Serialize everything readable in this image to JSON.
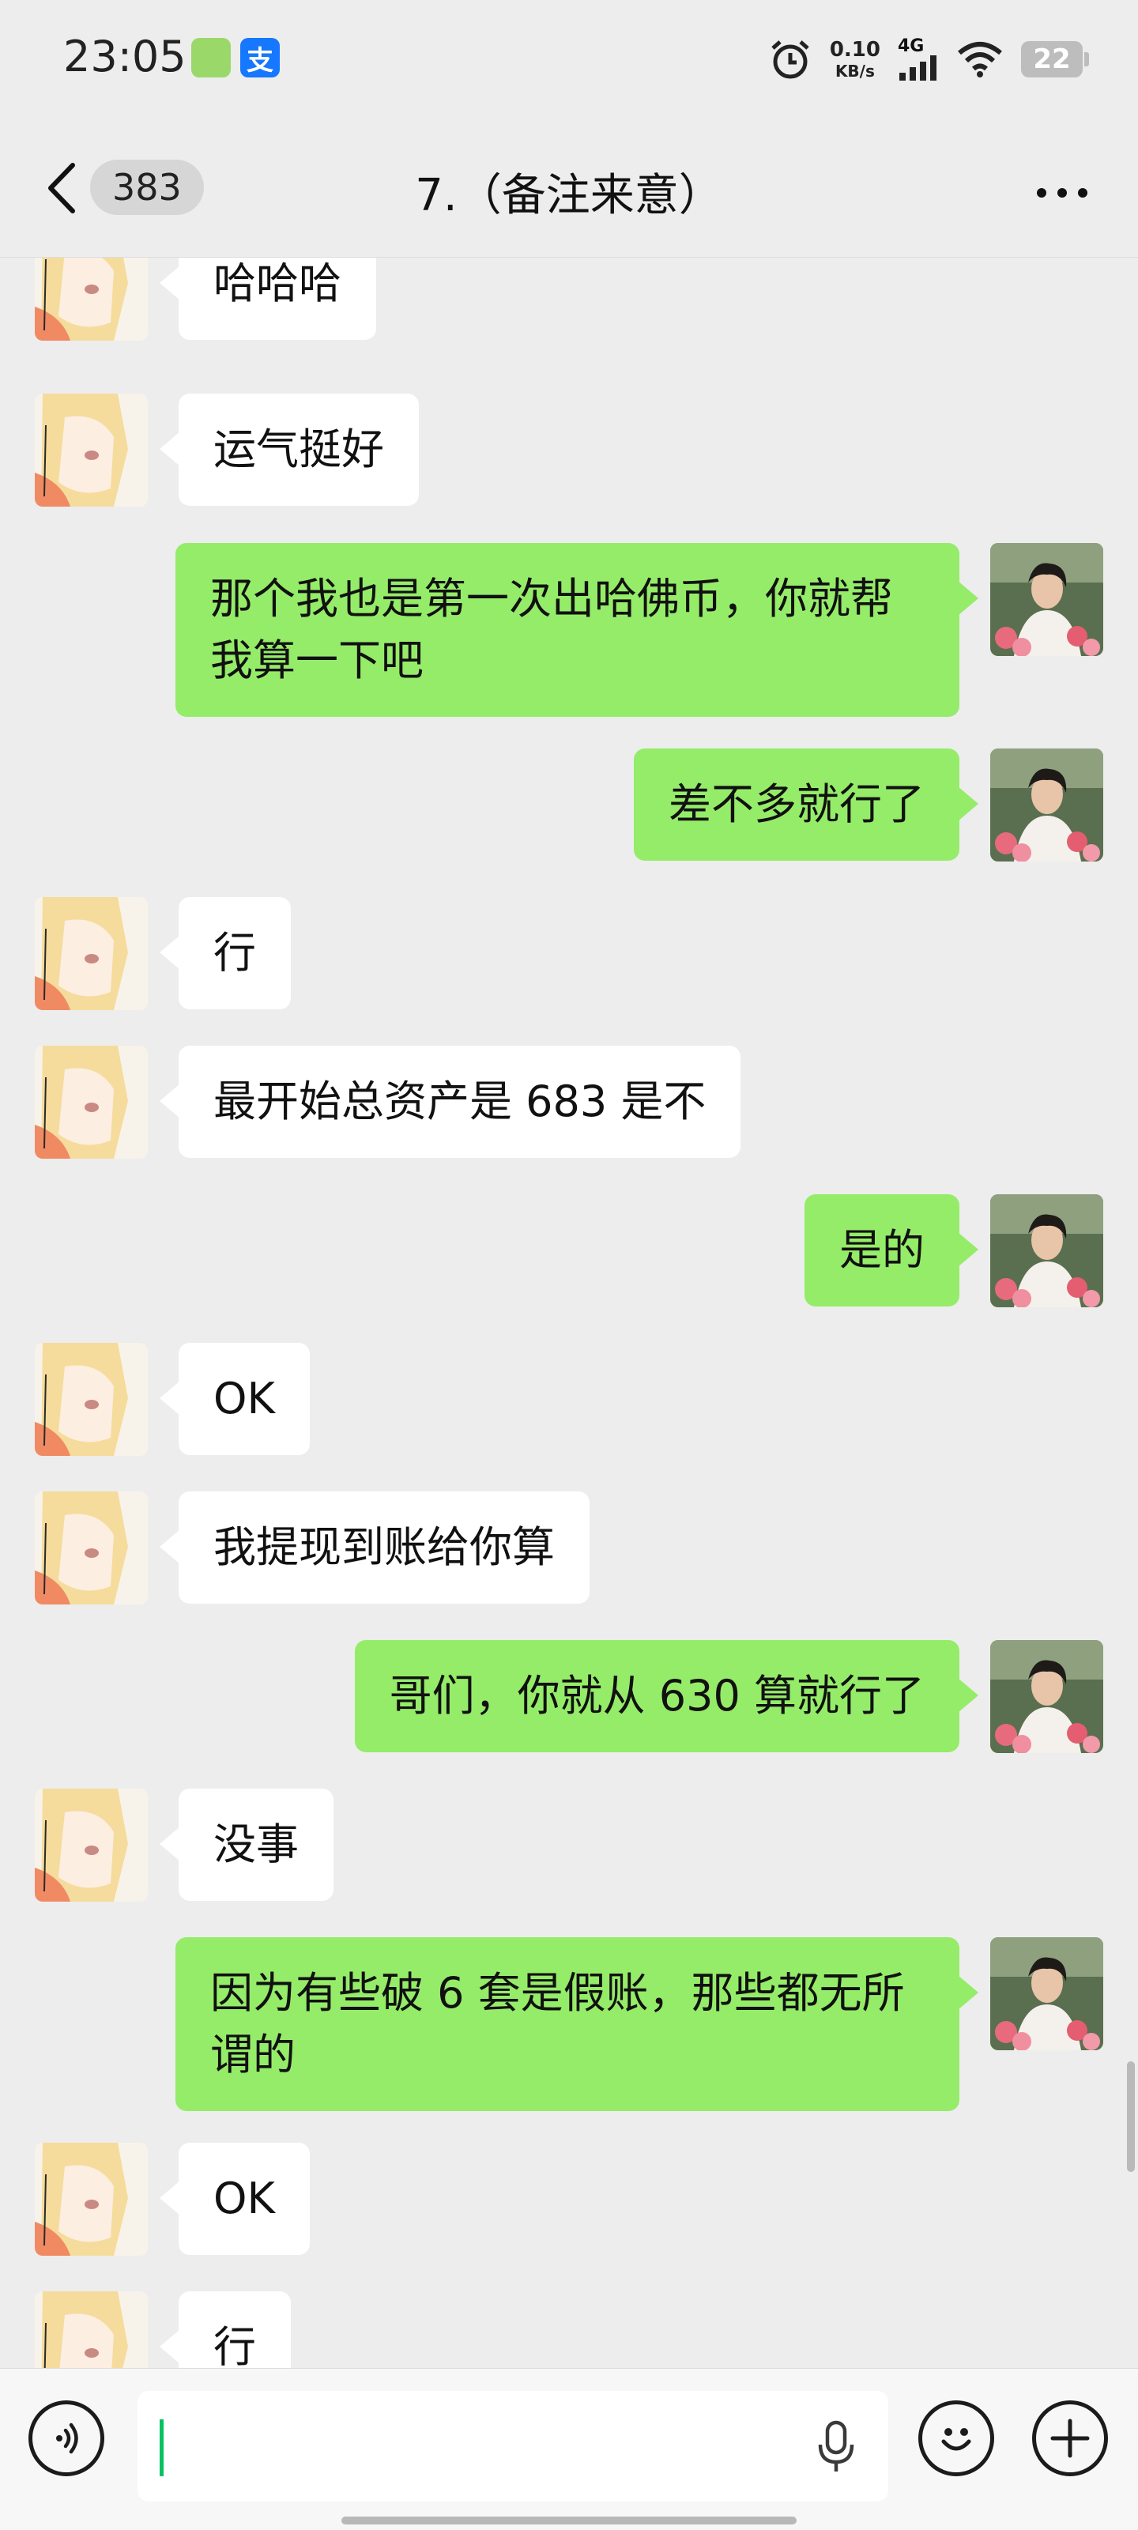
{
  "status_bar": {
    "time": "23:05",
    "network_speed_value": "0.10",
    "network_speed_unit": "KB/s",
    "network_type": "4G",
    "battery_level": "22"
  },
  "nav": {
    "unread_count": "383",
    "title": "7.（备注来意）"
  },
  "messages": [
    {
      "side": "left",
      "text": "哈哈哈"
    },
    {
      "side": "left",
      "text": "运气挺好"
    },
    {
      "side": "right",
      "text": "那个我也是第一次出哈佛币，你就帮我算一下吧"
    },
    {
      "side": "right",
      "text": "差不多就行了"
    },
    {
      "side": "left",
      "text": "行"
    },
    {
      "side": "left",
      "text": "最开始总资产是 683 是不"
    },
    {
      "side": "right",
      "text": "是的"
    },
    {
      "side": "left",
      "text": "OK"
    },
    {
      "side": "left",
      "text": "我提现到账给你算"
    },
    {
      "side": "right",
      "text": "哥们，你就从 630 算就行了"
    },
    {
      "side": "left",
      "text": "没事"
    },
    {
      "side": "right",
      "text": "因为有些破 6 套是假账，那些都无所谓的"
    },
    {
      "side": "left",
      "text": "OK"
    },
    {
      "side": "left",
      "text": "行"
    }
  ],
  "input": {
    "value": ""
  },
  "colors": {
    "background": "#ededed",
    "outgoing_bubble": "#95ec69",
    "incoming_bubble": "#ffffff",
    "caret": "#07c160"
  }
}
